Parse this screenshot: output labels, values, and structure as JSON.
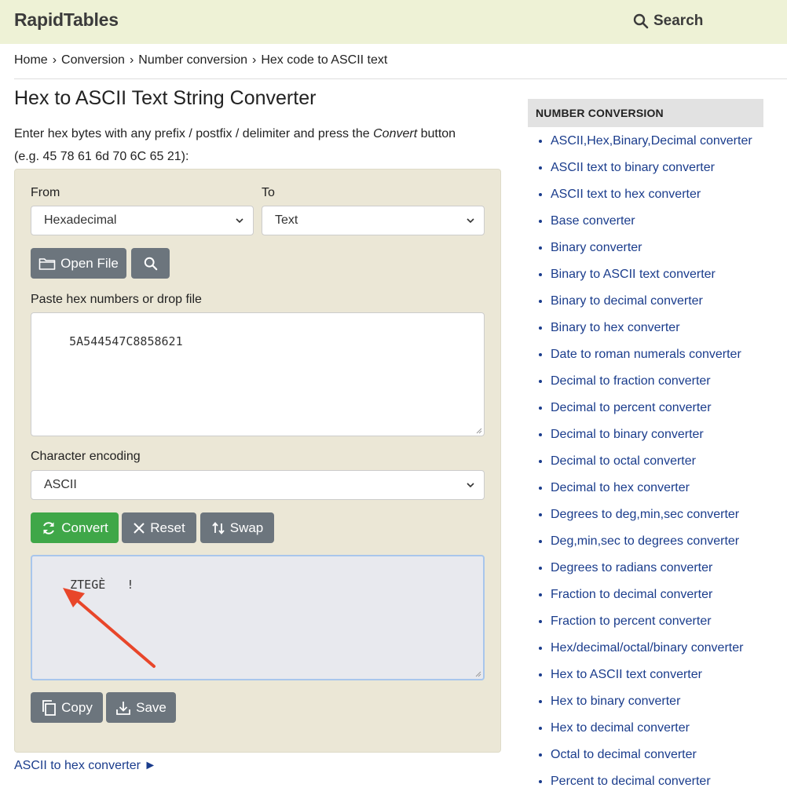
{
  "header": {
    "logo": "RapidTables",
    "search_label": "Search"
  },
  "breadcrumb": [
    "Home",
    "Conversion",
    "Number conversion",
    "Hex code to ASCII text"
  ],
  "page": {
    "title": "Hex to ASCII Text String Converter",
    "intro_before": "Enter hex bytes with any prefix / postfix / delimiter and press the ",
    "intro_em": "Convert",
    "intro_after": " button",
    "intro_example": "(e.g. 45 78 61 6d 70 6C 65 21):"
  },
  "converter": {
    "from_label": "From",
    "from_value": "Hexadecimal",
    "to_label": "To",
    "to_value": "Text",
    "open_file_label": "Open File",
    "input_label": "Paste hex numbers or drop file",
    "input_value": "5A544547C8858621",
    "encoding_label": "Character encoding",
    "encoding_value": "ASCII",
    "convert_label": "Convert",
    "reset_label": "Reset",
    "swap_label": "Swap",
    "output_value": "ZTEGÈ   !",
    "copy_label": "Copy",
    "save_label": "Save"
  },
  "bottom_link": "ASCII to hex converter ►",
  "sidebar": {
    "heading": "NUMBER CONVERSION",
    "items": [
      "ASCII,Hex,Binary,Decimal converter",
      "ASCII text to binary converter",
      "ASCII text to hex converter",
      "Base converter",
      "Binary converter",
      "Binary to ASCII text converter",
      "Binary to decimal converter",
      "Binary to hex converter",
      "Date to roman numerals converter",
      "Decimal to fraction converter",
      "Decimal to percent converter",
      "Decimal to binary converter",
      "Decimal to octal converter",
      "Decimal to hex converter",
      "Degrees to deg,min,sec converter",
      "Deg,min,sec to degrees converter",
      "Degrees to radians converter",
      "Fraction to decimal converter",
      "Fraction to percent converter",
      "Hex/decimal/octal/binary converter",
      "Hex to ASCII text converter",
      "Hex to binary converter",
      "Hex to decimal converter",
      "Octal to decimal converter",
      "Percent to decimal converter"
    ]
  },
  "colors": {
    "header_bg": "#eef2d6",
    "panel_bg": "#ebe7d6",
    "button_gray": "#6c757d",
    "button_green": "#3fa748",
    "link_blue": "#1a3c8c",
    "annotation_arrow": "#e8462a"
  },
  "icons": [
    "search-icon",
    "folder-icon",
    "search-icon",
    "refresh-icon",
    "close-icon",
    "swap-icon",
    "copy-icon",
    "download-icon",
    "chevron-down-icon"
  ]
}
